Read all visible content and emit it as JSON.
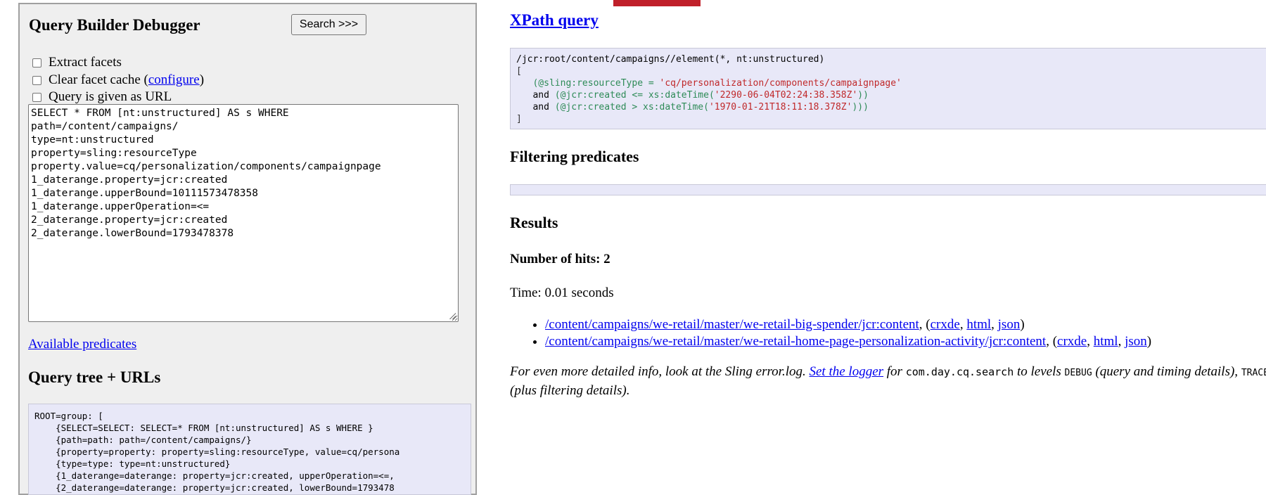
{
  "left": {
    "title": "Query Builder Debugger",
    "search_button": "Search >>>",
    "options": {
      "extract_facets": "Extract facets",
      "clear_cache_prefix": "Clear facet cache (",
      "clear_cache_link": "configure",
      "clear_cache_suffix": ")",
      "query_as_url": "Query is given as URL"
    },
    "query_lines": [
      "SELECT * FROM [nt:unstructured] AS s WHERE",
      "path=/content/campaigns/",
      "type=nt:unstructured",
      "property=sling:resourceType",
      "property.value=cq/personalization/components/campaignpage",
      "1_daterange.property=jcr:created",
      "1_daterange.upperBound=10111573478358",
      "1_daterange.upperOperation=<=",
      "2_daterange.property=jcr:created",
      "2_daterange.lowerBound=1793478378"
    ],
    "available_predicates": "Available predicates",
    "tree_heading": "Query tree + URLs",
    "tree_lines": [
      "ROOT=group: [",
      "    {SELECT=SELECT: SELECT=* FROM [nt:unstructured] AS s WHERE }",
      "    {path=path: path=/content/campaigns/}",
      "    {property=property: property=sling:resourceType, value=cq/persona",
      "    {type=type: type=nt:unstructured}",
      "    {1_daterange=daterange: property=jcr:created, upperOperation=<=,",
      "    {2_daterange=daterange: property=jcr:created, lowerBound=1793478"
    ]
  },
  "right": {
    "xpath_title": "XPath query",
    "xpath": {
      "line1": "/jcr:root/content/campaigns//element(*, nt:unstructured)",
      "open": "[",
      "l3_attr": "(@sling:resourceType = ",
      "l3_val": "'cq/personalization/components/campaignpage'",
      "l4_and": "and ",
      "l4_attr": "(@jcr:created <= xs:dateTime(",
      "l4_val": "'2290-06-04T02:24:38.358Z'",
      "l4_close": "))",
      "l5_and": "and ",
      "l5_attr": "(@jcr:created > xs:dateTime(",
      "l5_val": "'1970-01-21T18:11:18.378Z'",
      "l5_close": ")))",
      "close": "]"
    },
    "filtering_heading": "Filtering predicates",
    "results_heading": "Results",
    "hits": "Number of hits: 2",
    "time": "Time: 0.01 seconds",
    "results": [
      {
        "path": "/content/campaigns/we-retail/master/we-retail-big-spender/jcr:content",
        "crxde": "crxde",
        "html": "html",
        "json": "json"
      },
      {
        "path": "/content/campaigns/we-retail/master/we-retail-home-page-personalization-activity/jcr:content",
        "crxde": "crxde",
        "html": "html",
        "json": "json"
      }
    ],
    "footnote": {
      "part1": "For even more detailed info, look at the Sling error.log. ",
      "link": "Set the logger",
      "part2": " for ",
      "package": "com.day.cq.search",
      "part3": " to levels ",
      "debug": "DEBUG",
      "part4": " (query and timing details), ",
      "trace": "TRACE",
      "part5": " (plus filtering details)."
    }
  },
  "colors": {
    "panel_bg": "#efefef",
    "code_bg": "#e8e8f8",
    "accent_red": "#c0202a",
    "link": "#0000ee"
  }
}
